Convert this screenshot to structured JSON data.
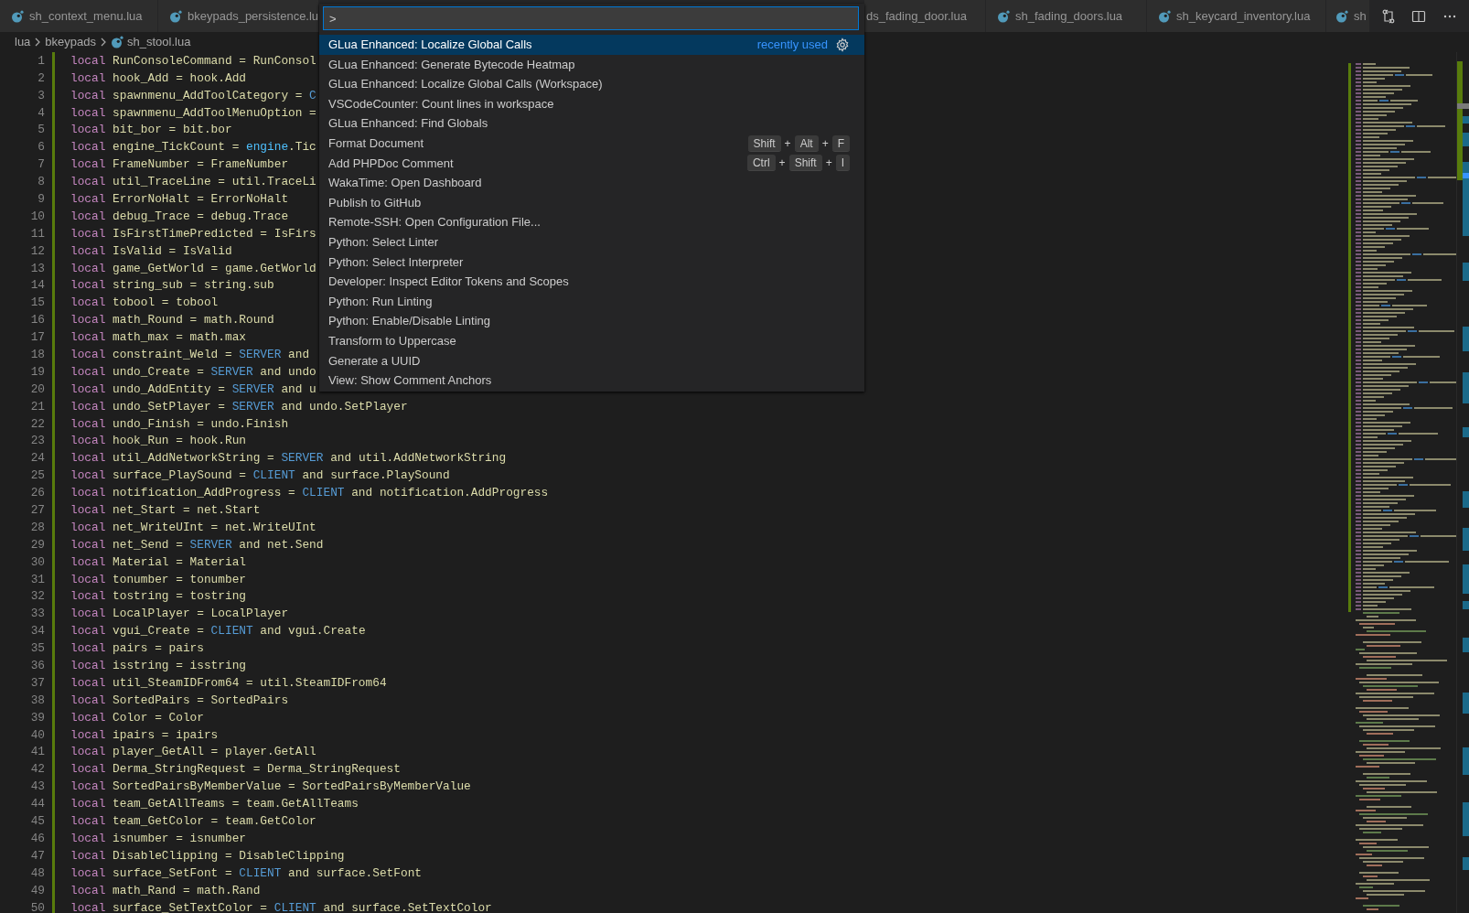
{
  "tabs": [
    {
      "label": "sh_context_menu.lua",
      "file_icon": true
    },
    {
      "label": "bkeypads_persistence.lu",
      "file_icon": true
    },
    {
      "label": "ds_fading_door.lua",
      "file_icon": false
    },
    {
      "label": "sh_fading_doors.lua",
      "file_icon": true
    },
    {
      "label": "sh_keycard_inventory.lua",
      "file_icon": true
    },
    {
      "label": "sh",
      "file_icon": true
    }
  ],
  "breadcrumb": [
    "lua",
    "bkeypads",
    "sh_stool.lua"
  ],
  "command_palette": {
    "value": ">",
    "items": [
      {
        "label": "GLua Enhanced: Localize Global Calls",
        "selected": true,
        "detail": "recently used"
      },
      {
        "label": "GLua Enhanced: Generate Bytecode Heatmap",
        "selected": false
      },
      {
        "label": "GLua Enhanced: Localize Global Calls (Workspace)",
        "selected": false
      },
      {
        "label": "VSCodeCounter: Count lines in workspace",
        "selected": false
      },
      {
        "label": "GLua Enhanced: Find Globals",
        "selected": false
      },
      {
        "label": "Format Document",
        "selected": false,
        "keybinding": [
          {
            "kind": "key",
            "text": "Shift"
          },
          {
            "kind": "separator",
            "text": "+"
          },
          {
            "kind": "key",
            "text": "Alt"
          },
          {
            "kind": "separator",
            "text": "+"
          },
          {
            "kind": "key",
            "text": "F"
          }
        ]
      },
      {
        "label": "Add PHPDoc Comment",
        "selected": false,
        "keybinding": [
          {
            "kind": "key",
            "text": "Ctrl"
          },
          {
            "kind": "separator",
            "text": "+"
          },
          {
            "kind": "key",
            "text": "Shift"
          },
          {
            "kind": "separator",
            "text": "+"
          },
          {
            "kind": "key",
            "text": "I"
          }
        ]
      },
      {
        "label": "WakaTime: Open Dashboard",
        "selected": false
      },
      {
        "label": "Publish to GitHub",
        "selected": false
      },
      {
        "label": "Remote-SSH: Open Configuration File...",
        "selected": false
      },
      {
        "label": "Python: Select Linter",
        "selected": false
      },
      {
        "label": "Python: Select Interpreter",
        "selected": false
      },
      {
        "label": "Developer: Inspect Editor Tokens and Scopes",
        "selected": false
      },
      {
        "label": "Python: Run Linting",
        "selected": false
      },
      {
        "label": "Python: Enable/Disable Linting",
        "selected": false
      },
      {
        "label": "Transform to Uppercase",
        "selected": false
      },
      {
        "label": "Generate a UUID",
        "selected": false
      },
      {
        "label": "View: Show Comment Anchors",
        "selected": false
      }
    ]
  },
  "code_lines": [
    {
      "number": "1",
      "tokens": [
        {
          "kind": "keyword",
          "text": "local"
        },
        {
          "kind": "plain",
          "text": " RunConsoleCommand = RunConsol"
        }
      ]
    },
    {
      "number": "2",
      "tokens": [
        {
          "kind": "keyword",
          "text": "local"
        },
        {
          "kind": "plain",
          "text": " hook_Add = hook.Add"
        }
      ]
    },
    {
      "number": "3",
      "tokens": [
        {
          "kind": "keyword",
          "text": "local"
        },
        {
          "kind": "plain",
          "text": " spawnmenu_AddToolCategory = "
        },
        {
          "kind": "constant",
          "text": "C"
        }
      ]
    },
    {
      "number": "4",
      "tokens": [
        {
          "kind": "keyword",
          "text": "local"
        },
        {
          "kind": "plain",
          "text": " spawnmenu_AddToolMenuOption ="
        }
      ]
    },
    {
      "number": "5",
      "tokens": [
        {
          "kind": "keyword",
          "text": "local"
        },
        {
          "kind": "plain",
          "text": " bit_bor = bit.bor"
        }
      ]
    },
    {
      "number": "6",
      "tokens": [
        {
          "kind": "keyword",
          "text": "local"
        },
        {
          "kind": "plain",
          "text": " engine_TickCount = "
        },
        {
          "kind": "library",
          "text": "engine"
        },
        {
          "kind": "plain",
          "text": ".Tic"
        }
      ]
    },
    {
      "number": "7",
      "tokens": [
        {
          "kind": "keyword",
          "text": "local"
        },
        {
          "kind": "plain",
          "text": " FrameNumber = FrameNumber"
        }
      ]
    },
    {
      "number": "8",
      "tokens": [
        {
          "kind": "keyword",
          "text": "local"
        },
        {
          "kind": "plain",
          "text": " util_TraceLine = util.TraceLi"
        }
      ]
    },
    {
      "number": "9",
      "tokens": [
        {
          "kind": "keyword",
          "text": "local"
        },
        {
          "kind": "plain",
          "text": " ErrorNoHalt = ErrorNoHalt"
        }
      ]
    },
    {
      "number": "10",
      "tokens": [
        {
          "kind": "keyword",
          "text": "local"
        },
        {
          "kind": "plain",
          "text": " debug_Trace = debug.Trace"
        }
      ]
    },
    {
      "number": "11",
      "tokens": [
        {
          "kind": "keyword",
          "text": "local"
        },
        {
          "kind": "plain",
          "text": " IsFirstTimePredicted = IsFirs"
        }
      ]
    },
    {
      "number": "12",
      "tokens": [
        {
          "kind": "keyword",
          "text": "local"
        },
        {
          "kind": "plain",
          "text": " IsValid = IsValid"
        }
      ]
    },
    {
      "number": "13",
      "tokens": [
        {
          "kind": "keyword",
          "text": "local"
        },
        {
          "kind": "plain",
          "text": " game_GetWorld = game.GetWorld"
        }
      ]
    },
    {
      "number": "14",
      "tokens": [
        {
          "kind": "keyword",
          "text": "local"
        },
        {
          "kind": "plain",
          "text": " string_sub = string.sub"
        }
      ]
    },
    {
      "number": "15",
      "tokens": [
        {
          "kind": "keyword",
          "text": "local"
        },
        {
          "kind": "plain",
          "text": " tobool = tobool"
        }
      ]
    },
    {
      "number": "16",
      "tokens": [
        {
          "kind": "keyword",
          "text": "local"
        },
        {
          "kind": "plain",
          "text": " math_Round = math.Round"
        }
      ]
    },
    {
      "number": "17",
      "tokens": [
        {
          "kind": "keyword",
          "text": "local"
        },
        {
          "kind": "plain",
          "text": " math_max = math.max"
        }
      ]
    },
    {
      "number": "18",
      "tokens": [
        {
          "kind": "keyword",
          "text": "local"
        },
        {
          "kind": "plain",
          "text": " constraint_Weld = "
        },
        {
          "kind": "constant",
          "text": "SERVER"
        },
        {
          "kind": "plain",
          "text": " and"
        }
      ]
    },
    {
      "number": "19",
      "tokens": [
        {
          "kind": "keyword",
          "text": "local"
        },
        {
          "kind": "plain",
          "text": " undo_Create = "
        },
        {
          "kind": "constant",
          "text": "SERVER"
        },
        {
          "kind": "plain",
          "text": " and undo"
        }
      ]
    },
    {
      "number": "20",
      "tokens": [
        {
          "kind": "keyword",
          "text": "local"
        },
        {
          "kind": "plain",
          "text": " undo_AddEntity = "
        },
        {
          "kind": "constant",
          "text": "SERVER"
        },
        {
          "kind": "plain",
          "text": " and u"
        }
      ]
    },
    {
      "number": "21",
      "tokens": [
        {
          "kind": "keyword",
          "text": "local"
        },
        {
          "kind": "plain",
          "text": " undo_SetPlayer = "
        },
        {
          "kind": "constant",
          "text": "SERVER"
        },
        {
          "kind": "plain",
          "text": " and undo.SetPlayer"
        }
      ]
    },
    {
      "number": "22",
      "tokens": [
        {
          "kind": "keyword",
          "text": "local"
        },
        {
          "kind": "plain",
          "text": " undo_Finish = undo.Finish"
        }
      ]
    },
    {
      "number": "23",
      "tokens": [
        {
          "kind": "keyword",
          "text": "local"
        },
        {
          "kind": "plain",
          "text": " hook_Run = hook.Run"
        }
      ]
    },
    {
      "number": "24",
      "tokens": [
        {
          "kind": "keyword",
          "text": "local"
        },
        {
          "kind": "plain",
          "text": " util_AddNetworkString = "
        },
        {
          "kind": "constant",
          "text": "SERVER"
        },
        {
          "kind": "plain",
          "text": " and util.AddNetworkString"
        }
      ]
    },
    {
      "number": "25",
      "tokens": [
        {
          "kind": "keyword",
          "text": "local"
        },
        {
          "kind": "plain",
          "text": " surface_PlaySound = "
        },
        {
          "kind": "constant",
          "text": "CLIENT"
        },
        {
          "kind": "plain",
          "text": " and surface.PlaySound"
        }
      ]
    },
    {
      "number": "26",
      "tokens": [
        {
          "kind": "keyword",
          "text": "local"
        },
        {
          "kind": "plain",
          "text": " notification_AddProgress = "
        },
        {
          "kind": "constant",
          "text": "CLIENT"
        },
        {
          "kind": "plain",
          "text": " and notification.AddProgress"
        }
      ]
    },
    {
      "number": "27",
      "tokens": [
        {
          "kind": "keyword",
          "text": "local"
        },
        {
          "kind": "plain",
          "text": " net_Start = net.Start"
        }
      ]
    },
    {
      "number": "28",
      "tokens": [
        {
          "kind": "keyword",
          "text": "local"
        },
        {
          "kind": "plain",
          "text": " net_WriteUInt = net.WriteUInt"
        }
      ]
    },
    {
      "number": "29",
      "tokens": [
        {
          "kind": "keyword",
          "text": "local"
        },
        {
          "kind": "plain",
          "text": " net_Send = "
        },
        {
          "kind": "constant",
          "text": "SERVER"
        },
        {
          "kind": "plain",
          "text": " and net.Send"
        }
      ]
    },
    {
      "number": "30",
      "tokens": [
        {
          "kind": "keyword",
          "text": "local"
        },
        {
          "kind": "plain",
          "text": " Material = Material"
        }
      ]
    },
    {
      "number": "31",
      "tokens": [
        {
          "kind": "keyword",
          "text": "local"
        },
        {
          "kind": "plain",
          "text": " tonumber = tonumber"
        }
      ]
    },
    {
      "number": "32",
      "tokens": [
        {
          "kind": "keyword",
          "text": "local"
        },
        {
          "kind": "plain",
          "text": " tostring = tostring"
        }
      ]
    },
    {
      "number": "33",
      "tokens": [
        {
          "kind": "keyword",
          "text": "local"
        },
        {
          "kind": "plain",
          "text": " LocalPlayer = LocalPlayer"
        }
      ]
    },
    {
      "number": "34",
      "tokens": [
        {
          "kind": "keyword",
          "text": "local"
        },
        {
          "kind": "plain",
          "text": " vgui_Create = "
        },
        {
          "kind": "constant",
          "text": "CLIENT"
        },
        {
          "kind": "plain",
          "text": " and vgui.Create"
        }
      ]
    },
    {
      "number": "35",
      "tokens": [
        {
          "kind": "keyword",
          "text": "local"
        },
        {
          "kind": "plain",
          "text": " pairs = pairs"
        }
      ]
    },
    {
      "number": "36",
      "tokens": [
        {
          "kind": "keyword",
          "text": "local"
        },
        {
          "kind": "plain",
          "text": " isstring = isstring"
        }
      ]
    },
    {
      "number": "37",
      "tokens": [
        {
          "kind": "keyword",
          "text": "local"
        },
        {
          "kind": "plain",
          "text": " util_SteamIDFrom64 = util.SteamIDFrom64"
        }
      ]
    },
    {
      "number": "38",
      "tokens": [
        {
          "kind": "keyword",
          "text": "local"
        },
        {
          "kind": "plain",
          "text": " SortedPairs = SortedPairs"
        }
      ]
    },
    {
      "number": "39",
      "tokens": [
        {
          "kind": "keyword",
          "text": "local"
        },
        {
          "kind": "plain",
          "text": " Color = Color"
        }
      ]
    },
    {
      "number": "40",
      "tokens": [
        {
          "kind": "keyword",
          "text": "local"
        },
        {
          "kind": "plain",
          "text": " ipairs = ipairs"
        }
      ]
    },
    {
      "number": "41",
      "tokens": [
        {
          "kind": "keyword",
          "text": "local"
        },
        {
          "kind": "plain",
          "text": " player_GetAll = player.GetAll"
        }
      ]
    },
    {
      "number": "42",
      "tokens": [
        {
          "kind": "keyword",
          "text": "local"
        },
        {
          "kind": "plain",
          "text": " Derma_StringRequest = Derma_StringRequest"
        }
      ]
    },
    {
      "number": "43",
      "tokens": [
        {
          "kind": "keyword",
          "text": "local"
        },
        {
          "kind": "plain",
          "text": " SortedPairsByMemberValue = SortedPairsByMemberValue"
        }
      ]
    },
    {
      "number": "44",
      "tokens": [
        {
          "kind": "keyword",
          "text": "local"
        },
        {
          "kind": "plain",
          "text": " team_GetAllTeams = team.GetAllTeams"
        }
      ]
    },
    {
      "number": "45",
      "tokens": [
        {
          "kind": "keyword",
          "text": "local"
        },
        {
          "kind": "plain",
          "text": " team_GetColor = team.GetColor"
        }
      ]
    },
    {
      "number": "46",
      "tokens": [
        {
          "kind": "keyword",
          "text": "local"
        },
        {
          "kind": "plain",
          "text": " isnumber = isnumber"
        }
      ]
    },
    {
      "number": "47",
      "tokens": [
        {
          "kind": "keyword",
          "text": "local"
        },
        {
          "kind": "plain",
          "text": " DisableClipping = DisableClipping"
        }
      ]
    },
    {
      "number": "48",
      "tokens": [
        {
          "kind": "keyword",
          "text": "local"
        },
        {
          "kind": "plain",
          "text": " surface_SetFont = "
        },
        {
          "kind": "constant",
          "text": "CLIENT"
        },
        {
          "kind": "plain",
          "text": " and surface.SetFont"
        }
      ]
    },
    {
      "number": "49",
      "tokens": [
        {
          "kind": "keyword",
          "text": "local"
        },
        {
          "kind": "plain",
          "text": " math_Rand = math.Rand"
        }
      ]
    },
    {
      "number": "50",
      "tokens": [
        {
          "kind": "keyword",
          "text": "local"
        },
        {
          "kind": "plain",
          "text": " surface_SetTextColor = "
        },
        {
          "kind": "constant",
          "text": "CLIENT"
        },
        {
          "kind": "plain",
          "text": " and surface.SetTextColor"
        }
      ]
    }
  ]
}
